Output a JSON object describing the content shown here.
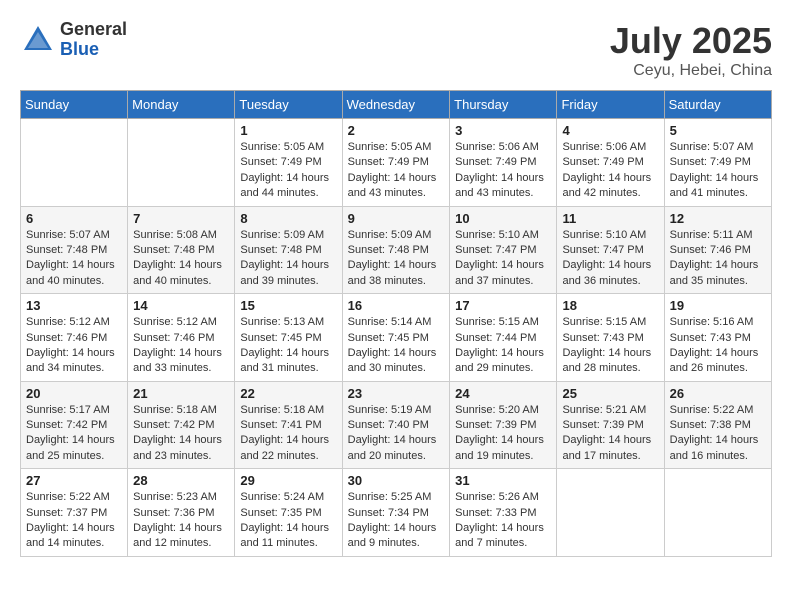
{
  "logo": {
    "general": "General",
    "blue": "Blue"
  },
  "title": {
    "month_year": "July 2025",
    "location": "Ceyu, Hebei, China"
  },
  "days_of_week": [
    "Sunday",
    "Monday",
    "Tuesday",
    "Wednesday",
    "Thursday",
    "Friday",
    "Saturday"
  ],
  "weeks": [
    [
      {
        "day": "",
        "info": ""
      },
      {
        "day": "",
        "info": ""
      },
      {
        "day": "1",
        "sunrise": "5:05 AM",
        "sunset": "7:49 PM",
        "daylight": "14 hours and 44 minutes."
      },
      {
        "day": "2",
        "sunrise": "5:05 AM",
        "sunset": "7:49 PM",
        "daylight": "14 hours and 43 minutes."
      },
      {
        "day": "3",
        "sunrise": "5:06 AM",
        "sunset": "7:49 PM",
        "daylight": "14 hours and 43 minutes."
      },
      {
        "day": "4",
        "sunrise": "5:06 AM",
        "sunset": "7:49 PM",
        "daylight": "14 hours and 42 minutes."
      },
      {
        "day": "5",
        "sunrise": "5:07 AM",
        "sunset": "7:49 PM",
        "daylight": "14 hours and 41 minutes."
      }
    ],
    [
      {
        "day": "6",
        "sunrise": "5:07 AM",
        "sunset": "7:48 PM",
        "daylight": "14 hours and 40 minutes."
      },
      {
        "day": "7",
        "sunrise": "5:08 AM",
        "sunset": "7:48 PM",
        "daylight": "14 hours and 40 minutes."
      },
      {
        "day": "8",
        "sunrise": "5:09 AM",
        "sunset": "7:48 PM",
        "daylight": "14 hours and 39 minutes."
      },
      {
        "day": "9",
        "sunrise": "5:09 AM",
        "sunset": "7:48 PM",
        "daylight": "14 hours and 38 minutes."
      },
      {
        "day": "10",
        "sunrise": "5:10 AM",
        "sunset": "7:47 PM",
        "daylight": "14 hours and 37 minutes."
      },
      {
        "day": "11",
        "sunrise": "5:10 AM",
        "sunset": "7:47 PM",
        "daylight": "14 hours and 36 minutes."
      },
      {
        "day": "12",
        "sunrise": "5:11 AM",
        "sunset": "7:46 PM",
        "daylight": "14 hours and 35 minutes."
      }
    ],
    [
      {
        "day": "13",
        "sunrise": "5:12 AM",
        "sunset": "7:46 PM",
        "daylight": "14 hours and 34 minutes."
      },
      {
        "day": "14",
        "sunrise": "5:12 AM",
        "sunset": "7:46 PM",
        "daylight": "14 hours and 33 minutes."
      },
      {
        "day": "15",
        "sunrise": "5:13 AM",
        "sunset": "7:45 PM",
        "daylight": "14 hours and 31 minutes."
      },
      {
        "day": "16",
        "sunrise": "5:14 AM",
        "sunset": "7:45 PM",
        "daylight": "14 hours and 30 minutes."
      },
      {
        "day": "17",
        "sunrise": "5:15 AM",
        "sunset": "7:44 PM",
        "daylight": "14 hours and 29 minutes."
      },
      {
        "day": "18",
        "sunrise": "5:15 AM",
        "sunset": "7:43 PM",
        "daylight": "14 hours and 28 minutes."
      },
      {
        "day": "19",
        "sunrise": "5:16 AM",
        "sunset": "7:43 PM",
        "daylight": "14 hours and 26 minutes."
      }
    ],
    [
      {
        "day": "20",
        "sunrise": "5:17 AM",
        "sunset": "7:42 PM",
        "daylight": "14 hours and 25 minutes."
      },
      {
        "day": "21",
        "sunrise": "5:18 AM",
        "sunset": "7:42 PM",
        "daylight": "14 hours and 23 minutes."
      },
      {
        "day": "22",
        "sunrise": "5:18 AM",
        "sunset": "7:41 PM",
        "daylight": "14 hours and 22 minutes."
      },
      {
        "day": "23",
        "sunrise": "5:19 AM",
        "sunset": "7:40 PM",
        "daylight": "14 hours and 20 minutes."
      },
      {
        "day": "24",
        "sunrise": "5:20 AM",
        "sunset": "7:39 PM",
        "daylight": "14 hours and 19 minutes."
      },
      {
        "day": "25",
        "sunrise": "5:21 AM",
        "sunset": "7:39 PM",
        "daylight": "14 hours and 17 minutes."
      },
      {
        "day": "26",
        "sunrise": "5:22 AM",
        "sunset": "7:38 PM",
        "daylight": "14 hours and 16 minutes."
      }
    ],
    [
      {
        "day": "27",
        "sunrise": "5:22 AM",
        "sunset": "7:37 PM",
        "daylight": "14 hours and 14 minutes."
      },
      {
        "day": "28",
        "sunrise": "5:23 AM",
        "sunset": "7:36 PM",
        "daylight": "14 hours and 12 minutes."
      },
      {
        "day": "29",
        "sunrise": "5:24 AM",
        "sunset": "7:35 PM",
        "daylight": "14 hours and 11 minutes."
      },
      {
        "day": "30",
        "sunrise": "5:25 AM",
        "sunset": "7:34 PM",
        "daylight": "14 hours and 9 minutes."
      },
      {
        "day": "31",
        "sunrise": "5:26 AM",
        "sunset": "7:33 PM",
        "daylight": "14 hours and 7 minutes."
      },
      {
        "day": "",
        "info": ""
      },
      {
        "day": "",
        "info": ""
      }
    ]
  ]
}
